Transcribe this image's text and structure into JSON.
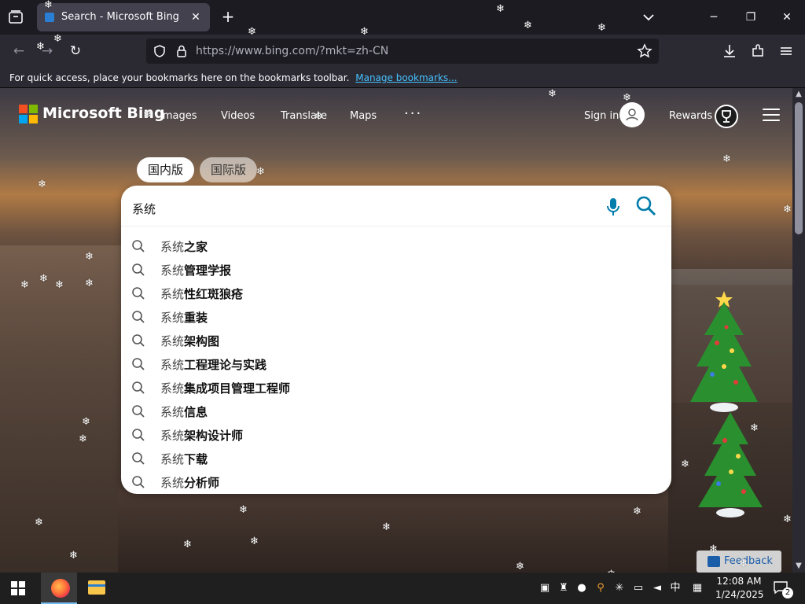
{
  "browser": {
    "tab_title": "Search - Microsoft Bing",
    "tab_close_glyph": "✕",
    "new_tab_glyph": "+",
    "url": "https://www.bing.com/?mkt=zh-CN",
    "bookmarks_message": "For quick access, place your bookmarks here on the bookmarks toolbar.",
    "bookmarks_link": "Manage bookmarks...",
    "window_controls": {
      "minimize": "─",
      "maximize": "❐",
      "close": "✕"
    },
    "nav": {
      "back": "←",
      "forward": "→",
      "reload": "↻"
    }
  },
  "bing": {
    "brand": "Microsoft Bing",
    "nav_links": [
      "Images",
      "Videos",
      "Translate",
      "Maps"
    ],
    "more": "···",
    "sign_in": "Sign in",
    "rewards": "Rewards",
    "region_tabs": [
      "国内版",
      "国际版"
    ],
    "active_region": "国内版",
    "search": {
      "value": "系统",
      "suggestions": [
        {
          "prefix": "系统",
          "rest": "之家"
        },
        {
          "prefix": "系统",
          "rest": "管理学报"
        },
        {
          "prefix": "系统",
          "rest": "性红斑狼疮"
        },
        {
          "prefix": "系统",
          "rest": "重装"
        },
        {
          "prefix": "系统",
          "rest": "架构图"
        },
        {
          "prefix": "系统",
          "rest": "工程理论与实践"
        },
        {
          "prefix": "系统",
          "rest": "集成项目管理工程师"
        },
        {
          "prefix": "系统",
          "rest": "信息"
        },
        {
          "prefix": "系统",
          "rest": "架构设计师"
        },
        {
          "prefix": "系统",
          "rest": "下载"
        },
        {
          "prefix": "系统",
          "rest": "分析师"
        }
      ]
    },
    "feedback": "Feedback"
  },
  "taskbar": {
    "time": "12:08 AM",
    "date": "1/24/2025",
    "notification_count": "2",
    "input_method": "中"
  },
  "icons": {
    "shield": "shield-icon",
    "lock": "lock-icon",
    "star": "bookmark-star-icon",
    "snowflake": "❄"
  },
  "colors": {
    "bing_blue": "#007daa",
    "tab_bg": "#42414d",
    "chrome_bg": "#1c1b22",
    "link_blue": "#45c1ff"
  }
}
